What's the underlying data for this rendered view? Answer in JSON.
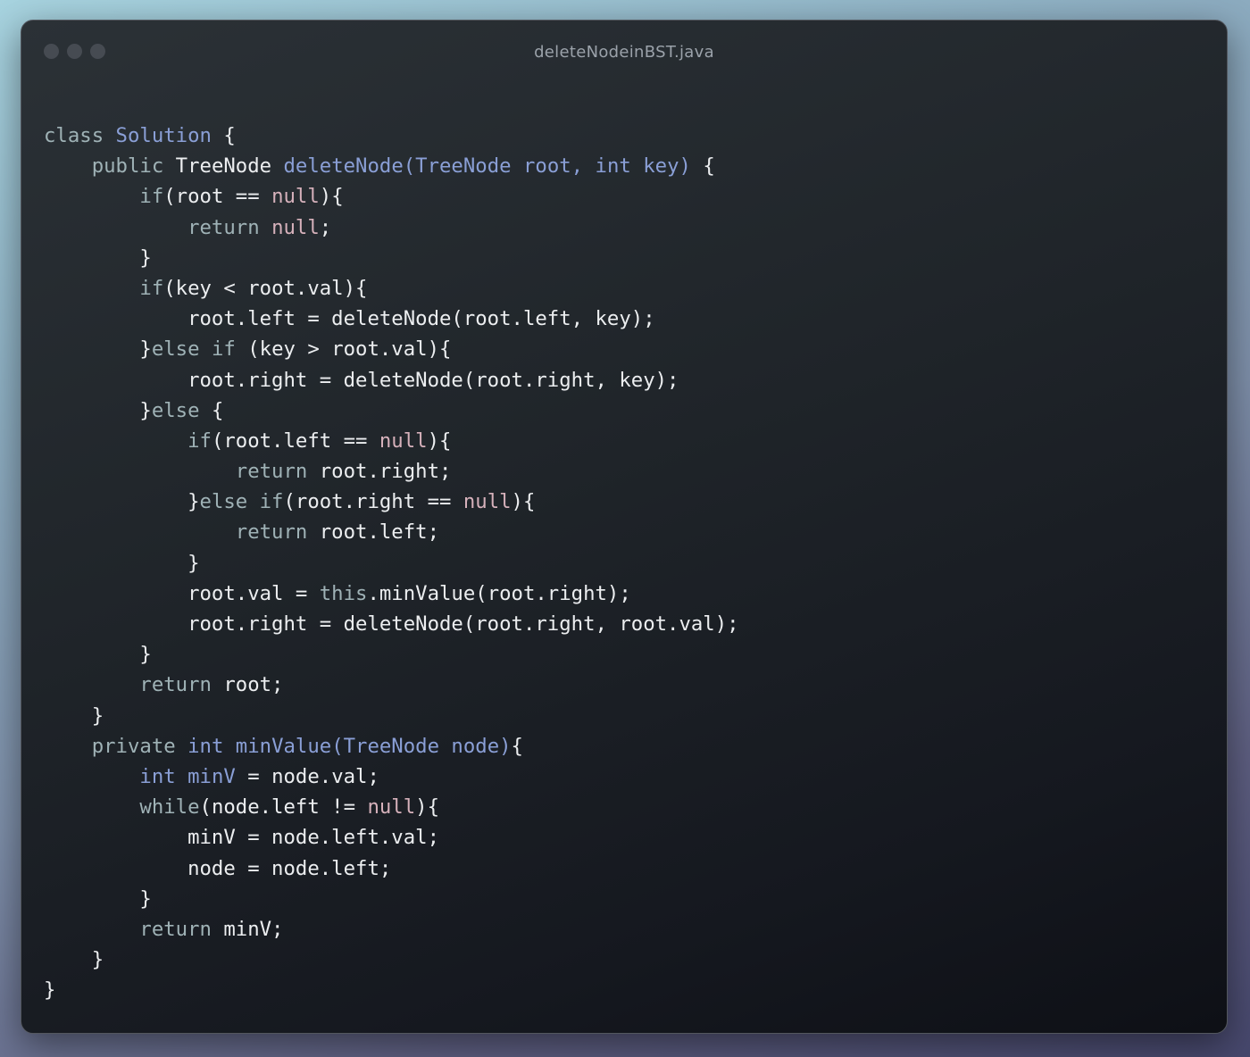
{
  "window": {
    "title": "deleteNodeinBST.java",
    "controls": [
      "close-dot",
      "minimize-dot",
      "zoom-dot"
    ]
  },
  "colors": {
    "keyword": "#9fb2b6",
    "type_or_function": "#8a9fd6",
    "null_literal": "#d6b1bb",
    "plain": "#eceef0",
    "window_background": "#1f2429"
  },
  "code": {
    "language": "java",
    "lines": [
      [
        {
          "t": "kw",
          "v": "class "
        },
        {
          "t": "cls",
          "v": "Solution"
        },
        {
          "t": "pl",
          "v": " {"
        }
      ],
      [
        {
          "t": "kw",
          "v": "    public "
        },
        {
          "t": "pl",
          "v": "TreeNode "
        },
        {
          "t": "fn",
          "v": "deleteNode(TreeNode root, int key)"
        },
        {
          "t": "pl",
          "v": " {"
        }
      ],
      [
        {
          "t": "kw",
          "v": "        if"
        },
        {
          "t": "pl",
          "v": "(root == "
        },
        {
          "t": "nul",
          "v": "null"
        },
        {
          "t": "pl",
          "v": "){"
        }
      ],
      [
        {
          "t": "kw",
          "v": "            return "
        },
        {
          "t": "nul",
          "v": "null"
        },
        {
          "t": "pl",
          "v": ";"
        }
      ],
      [
        {
          "t": "pl",
          "v": "        }"
        }
      ],
      [
        {
          "t": "kw",
          "v": "        if"
        },
        {
          "t": "pl",
          "v": "(key < root.val){"
        }
      ],
      [
        {
          "t": "pl",
          "v": "            root.left = deleteNode(root.left, key);"
        }
      ],
      [
        {
          "t": "pl",
          "v": "        }"
        },
        {
          "t": "kw",
          "v": "else if"
        },
        {
          "t": "pl",
          "v": " (key > root.val){"
        }
      ],
      [
        {
          "t": "pl",
          "v": "            root.right = deleteNode(root.right, key);"
        }
      ],
      [
        {
          "t": "pl",
          "v": "        }"
        },
        {
          "t": "kw",
          "v": "else"
        },
        {
          "t": "pl",
          "v": " {"
        }
      ],
      [
        {
          "t": "kw",
          "v": "            if"
        },
        {
          "t": "pl",
          "v": "(root.left == "
        },
        {
          "t": "nul",
          "v": "null"
        },
        {
          "t": "pl",
          "v": "){"
        }
      ],
      [
        {
          "t": "kw",
          "v": "                return "
        },
        {
          "t": "pl",
          "v": "root.right;"
        }
      ],
      [
        {
          "t": "pl",
          "v": "            }"
        },
        {
          "t": "kw",
          "v": "else if"
        },
        {
          "t": "pl",
          "v": "(root.right == "
        },
        {
          "t": "nul",
          "v": "null"
        },
        {
          "t": "pl",
          "v": "){"
        }
      ],
      [
        {
          "t": "kw",
          "v": "                return "
        },
        {
          "t": "pl",
          "v": "root.left;"
        }
      ],
      [
        {
          "t": "pl",
          "v": "            }"
        }
      ],
      [
        {
          "t": "pl",
          "v": "            root.val = "
        },
        {
          "t": "kw",
          "v": "this"
        },
        {
          "t": "pl",
          "v": ".minValue(root.right);"
        }
      ],
      [
        {
          "t": "pl",
          "v": "            root.right = deleteNode(root.right, root.val);"
        }
      ],
      [
        {
          "t": "pl",
          "v": "        }"
        }
      ],
      [
        {
          "t": "kw",
          "v": "        return "
        },
        {
          "t": "pl",
          "v": "root;"
        }
      ],
      [
        {
          "t": "pl",
          "v": "    }"
        }
      ],
      [
        {
          "t": "kw",
          "v": "    private "
        },
        {
          "t": "cls",
          "v": "int "
        },
        {
          "t": "fn",
          "v": "minValue(TreeNode node)"
        },
        {
          "t": "pl",
          "v": "{"
        }
      ],
      [
        {
          "t": "cls",
          "v": "        int "
        },
        {
          "t": "fn",
          "v": "minV"
        },
        {
          "t": "pl",
          "v": " = node.val;"
        }
      ],
      [
        {
          "t": "kw",
          "v": "        while"
        },
        {
          "t": "pl",
          "v": "(node.left != "
        },
        {
          "t": "nul",
          "v": "null"
        },
        {
          "t": "pl",
          "v": "){"
        }
      ],
      [
        {
          "t": "pl",
          "v": "            minV = node.left.val;"
        }
      ],
      [
        {
          "t": "pl",
          "v": "            node = node.left;"
        }
      ],
      [
        {
          "t": "pl",
          "v": "        }"
        }
      ],
      [
        {
          "t": "kw",
          "v": "        return "
        },
        {
          "t": "pl",
          "v": "minV;"
        }
      ],
      [
        {
          "t": "pl",
          "v": "    }"
        }
      ],
      [
        {
          "t": "pl",
          "v": "}"
        }
      ]
    ]
  }
}
